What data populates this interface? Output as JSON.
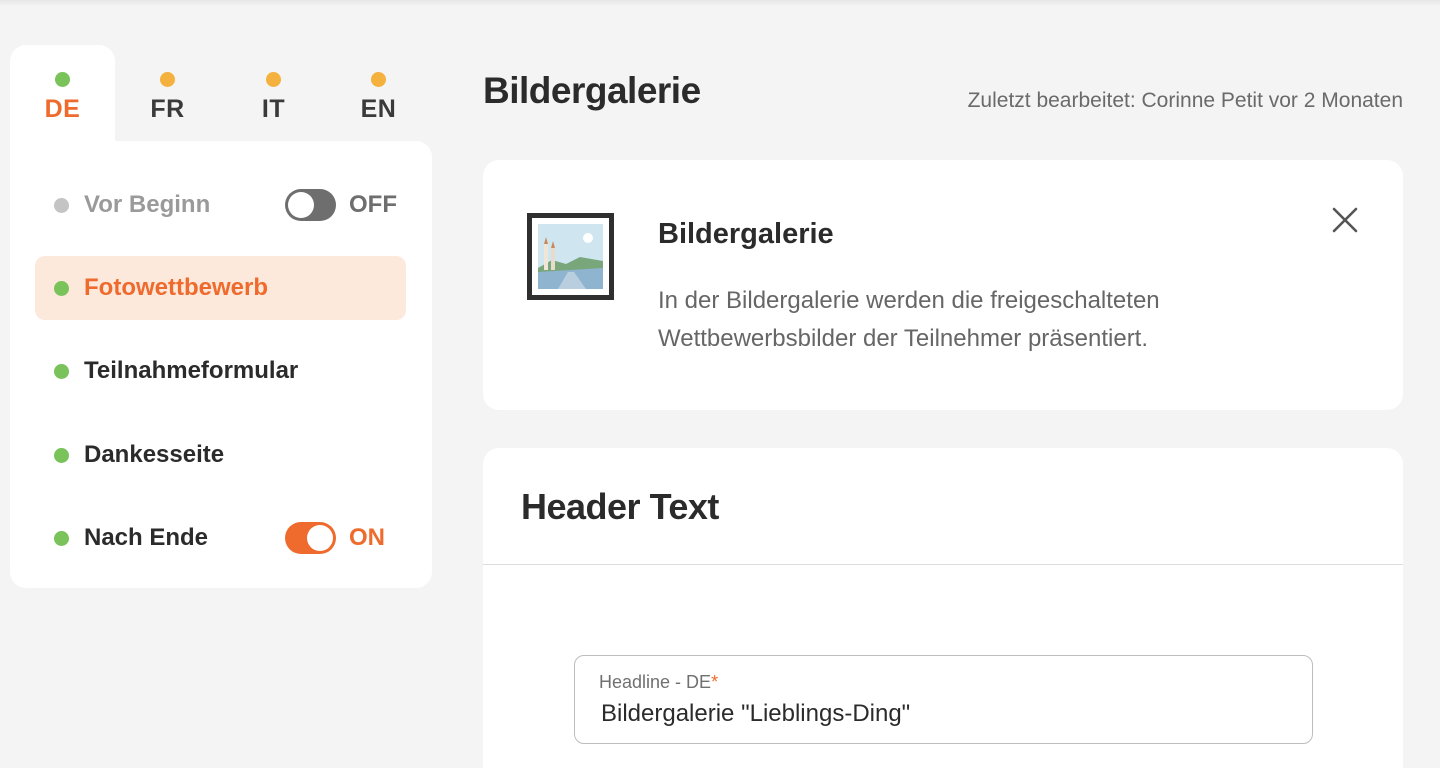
{
  "languages": [
    {
      "code": "DE",
      "status_color": "#7ac35a",
      "active": true
    },
    {
      "code": "FR",
      "status_color": "#f5b13d",
      "active": false
    },
    {
      "code": "IT",
      "status_color": "#f5b13d",
      "active": false
    },
    {
      "code": "EN",
      "status_color": "#f5b13d",
      "active": false
    }
  ],
  "nav": {
    "items": [
      {
        "label": "Vor Beginn",
        "dot_color": "#c4c4c4",
        "state": "disabled",
        "toggle": {
          "on": false,
          "label": "OFF"
        }
      },
      {
        "label": "Fotowettbewerb",
        "dot_color": "#7ac35a",
        "state": "selected"
      },
      {
        "label": "Teilnahmeformular",
        "dot_color": "#7ac35a",
        "state": "normal"
      },
      {
        "label": "Dankesseite",
        "dot_color": "#7ac35a",
        "state": "normal"
      },
      {
        "label": "Nach Ende",
        "dot_color": "#7ac35a",
        "state": "normal",
        "toggle": {
          "on": true,
          "label": "ON"
        }
      }
    ]
  },
  "header": {
    "title": "Bildergalerie",
    "last_edited": "Zuletzt bearbeitet: Corinne Petit vor 2 Monaten"
  },
  "info_card": {
    "title": "Bildergalerie",
    "description": "In der Bildergalerie werden die freigeschalteten Wettbewerbsbilder der Teilnehmer präsentiert.",
    "close_icon": "close-icon"
  },
  "section": {
    "title": "Header Text",
    "field": {
      "label": "Headline - DE",
      "required_mark": "*",
      "value": "Bildergalerie \"Lieblings-Ding\""
    }
  },
  "colors": {
    "accent": "#ee6b2d",
    "accent_light": "#fde8dc",
    "status_ok": "#7ac35a",
    "status_pending": "#f5b13d"
  }
}
